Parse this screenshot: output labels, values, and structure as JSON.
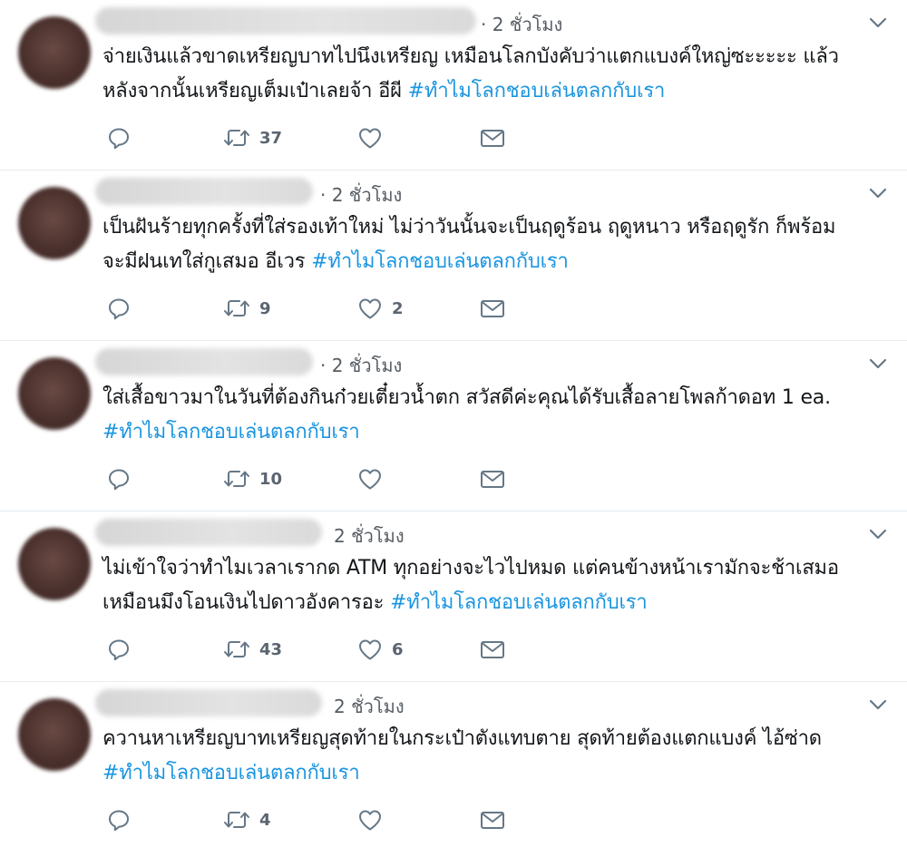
{
  "tweets": [
    {
      "time": "· 2 ชั่วโมง",
      "lines": [
        "จ่ายเงินแล้วขาดเหรียญบาทไปนึงเหรียญ เหมือนโลกบังคับว่าแตกแบงค์ใหญ่ซะะะะะ แล้ว",
        "หลังจากนั้นเหรียญเต็มเป๋าเลยจ้า อีผี "
      ],
      "hashtag": "#ทำไมโลกชอบเล่นตลกกับเรา",
      "hashtag_line": 1,
      "retweets": "37",
      "likes": ""
    },
    {
      "time": "· 2 ชั่วโมง",
      "lines": [
        "เป็นฝันร้ายทุกครั้งที่ใส่รองเท้าใหม่ ไม่ว่าวันนั้นจะเป็นฤดูร้อน ฤดูหนาว หรือฤดูรัก ก็พร้อม",
        "จะมีฝนเทใส่กูเสมอ อีเวร "
      ],
      "hashtag": "#ทำไมโลกชอบเล่นตลกกับเรา",
      "hashtag_line": 1,
      "retweets": "9",
      "likes": "2"
    },
    {
      "time": "· 2 ชั่วโมง",
      "lines": [
        "ใส่เสื้อขาวมาในวันที่ต้องกินก๋วยเตี๋ยวน้ำตก สวัสดีค่ะคุณได้รับเสื้อลายโพลก้าดอท 1 ea.",
        ""
      ],
      "hashtag": "#ทำไมโลกชอบเล่นตลกกับเรา",
      "hashtag_line": 1,
      "retweets": "10",
      "likes": ""
    },
    {
      "time": "2 ชั่วโมง",
      "lines": [
        "ไม่เข้าใจว่าทำไมเวลาเรากด ATM ทุกอย่างจะไวไปหมด แต่คนข้างหน้าเรามักจะช้าเสมอ",
        "เหมือนมึงโอนเงินไปดาวอังคารอะ "
      ],
      "hashtag": "#ทำไมโลกชอบเล่นตลกกับเรา",
      "hashtag_line": 1,
      "retweets": "43",
      "likes": "6"
    },
    {
      "time": "2 ชั่วโมง",
      "lines": [
        "ควานหาเหรียญบาทเหรียญสุดท้ายในกระเป๋าตังแทบตาย สุดท้ายต้องแตกแบงค์ ไอ้ซ่าด",
        ""
      ],
      "hashtag": "#ทำไมโลกชอบเล่นตลกกับเรา",
      "hashtag_line": 1,
      "retweets": "4",
      "likes": ""
    }
  ],
  "icons": {
    "reply": "reply-icon",
    "retweet": "retweet-icon",
    "like": "heart-icon",
    "dm": "envelope-icon",
    "more": "chevron-down-icon"
  },
  "colors": {
    "hashtag": "#1b95e0",
    "icon": "#657786",
    "text": "#14171a"
  }
}
